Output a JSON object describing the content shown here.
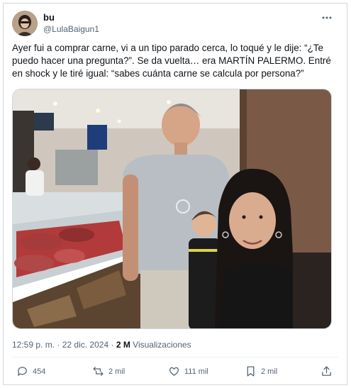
{
  "tweet": {
    "display_name": "bu",
    "handle": "@LulaBaigun1",
    "more_icon": "more-horizontal-icon",
    "text": "Ayer fui a comprar carne, vi a un tipo parado cerca, lo toqué y le dije: “¿Te puedo hacer una pregunta?”. Se da vuelta… era MARTÍN PALERMO. Entré en shock y le tiré igual: “sabes cuánta carne se calcula por persona?”",
    "time": "12:59 p. m.",
    "separator": "·",
    "date": "22 dic. 2024",
    "views_count": "2 M",
    "views_label": "Visualizaciones"
  },
  "actions": {
    "replies": "454",
    "reposts": "2 mil",
    "likes": "111 mil",
    "bookmarks": "2 mil",
    "icons": [
      "reply-icon",
      "repost-icon",
      "like-icon",
      "bookmark-icon",
      "share-icon"
    ]
  },
  "colors": {
    "text": "#0f1419",
    "secondary": "#536471",
    "border": "#cfd9de"
  }
}
